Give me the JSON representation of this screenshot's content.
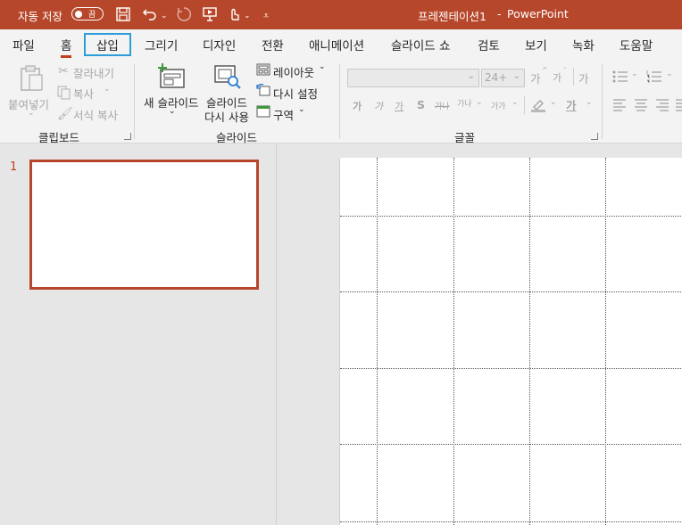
{
  "titlebar": {
    "autosave_label": "자동 저장",
    "autosave_state": "끔",
    "doc_title": "프레젠테이션1",
    "separator": "-",
    "app_name": "PowerPoint",
    "bg_color": "#b7472a"
  },
  "tabs": [
    "파일",
    "홈",
    "삽입",
    "그리기",
    "디자인",
    "전환",
    "애니메이션",
    "슬라이드 쇼",
    "검토",
    "보기",
    "녹화",
    "도움말"
  ],
  "active_tab": "홈",
  "focused_tab": "삽입",
  "clipboard": {
    "paste": "붙여넣기",
    "cut": "잘라내기",
    "copy": "복사",
    "format_painter": "서식 복사",
    "group_label": "클립보드"
  },
  "slides_group": {
    "new_slide_line1": "새 슬라이드",
    "reuse_line1": "슬라이드",
    "reuse_line2": "다시 사용",
    "layout": "레이아웃",
    "reset": "다시 설정",
    "section": "구역",
    "group_label": "슬라이드"
  },
  "font_group": {
    "font_name": "",
    "font_size": "24+",
    "grow": "가",
    "shrink": "가",
    "clear": "가",
    "bold": "가",
    "italic": "가",
    "underline": "가",
    "shadow": "S",
    "strike": "가나",
    "spacing": "가나",
    "case": "가가",
    "font_color": "가",
    "group_label": "글꼴"
  },
  "slide_panel": {
    "slide_number": "1"
  }
}
